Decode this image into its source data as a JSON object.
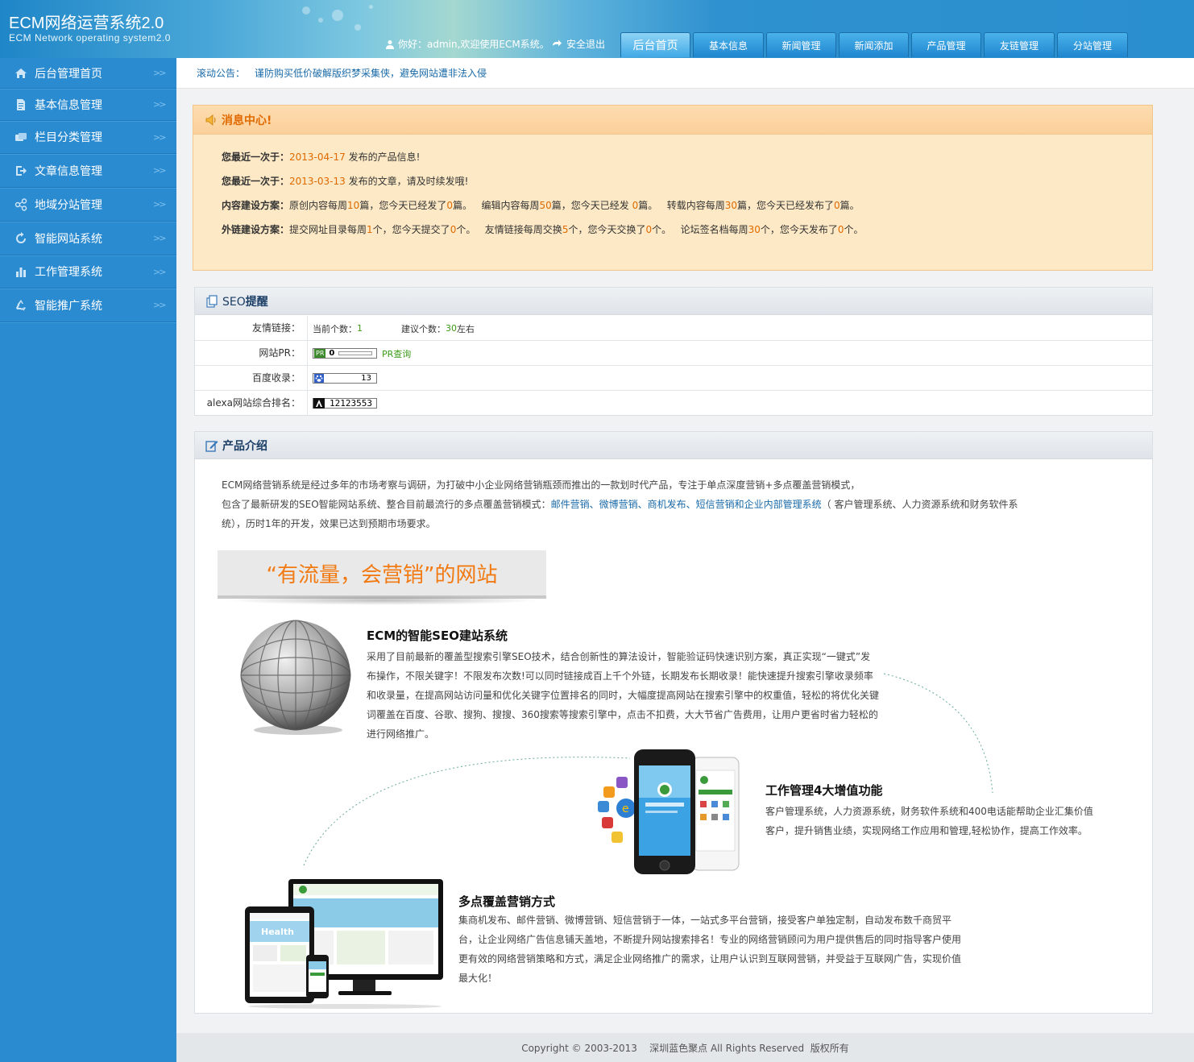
{
  "brand": {
    "title": "ECM网络运营系统2.0",
    "subtitle": "ECM Network operating system2.0"
  },
  "header": {
    "welcome": "你好：admin,欢迎使用ECM系统。",
    "logout": "安全退出",
    "tabs": [
      {
        "label": "后台首页",
        "active": true
      },
      {
        "label": "基本信息"
      },
      {
        "label": "新闻管理"
      },
      {
        "label": "新闻添加"
      },
      {
        "label": "产品管理"
      },
      {
        "label": "友链管理"
      },
      {
        "label": "分站管理"
      }
    ]
  },
  "sidebar": {
    "items": [
      {
        "label": "后台管理首页",
        "icon": "home-icon"
      },
      {
        "label": "基本信息管理",
        "icon": "document-icon"
      },
      {
        "label": "栏目分类管理",
        "icon": "category-icon"
      },
      {
        "label": "文章信息管理",
        "icon": "export-icon"
      },
      {
        "label": "地域分站管理",
        "icon": "share-icon"
      },
      {
        "label": "智能网站系统",
        "icon": "refresh-icon"
      },
      {
        "label": "工作管理系统",
        "icon": "bar-chart-icon"
      },
      {
        "label": "智能推广系统",
        "icon": "recycle-icon"
      }
    ],
    "chevron": ">>"
  },
  "notice": {
    "label": "滚动公告：",
    "text": "谨防购买低价破解版织梦采集侠，避免网站遭非法入侵"
  },
  "message_center": {
    "title": "消息中心!",
    "line1": {
      "prefix": "您最近一次于：",
      "date": "2013-04-17",
      "suffix": "发布的产品信息!"
    },
    "line2": {
      "prefix": "您最近一次于：",
      "date": "2013-03-13",
      "suffix": "发布的文章，请及时续发哦!"
    },
    "line3": {
      "label": "内容建设方案：",
      "a1": "原创内容每周",
      "n1": "10",
      "a2": "篇，您今天已经发了",
      "n2": "0",
      "a3": "篇。",
      "b1": "编辑内容每周",
      "n3": "50",
      "b2": "篇，您今天已经发",
      "n4": "0",
      "b3": "篇。",
      "c1": "转载内容每周",
      "n5": "30",
      "c2": "篇，您今天已经发布了",
      "n6": "0",
      "c3": "篇。"
    },
    "line4": {
      "label": "外链建设方案：",
      "a1": "提交网址目录每周",
      "n1": "1",
      "a2": "个，您今天提交了",
      "n2": "0",
      "a3": "个。",
      "b1": "友情链接每周交换",
      "n3": "5",
      "b2": "个，您今天交换了",
      "n4": "0",
      "b3": "个。",
      "c1": "论坛签名档每周",
      "n5": "30",
      "c2": "个，您今天发布了",
      "n6": "0",
      "c3": "个。"
    }
  },
  "seo": {
    "title": "SEO提醒",
    "title_prefix": "SEO",
    "title_suffix": "提醒",
    "rows": {
      "links": {
        "label": "友情链接：",
        "current_label": "当前个数：",
        "current": "1",
        "suggest_label": "建议个数：",
        "suggest": "30",
        "suggest_suffix": "左右"
      },
      "pr": {
        "label": "网站PR：",
        "badge": "PR",
        "value": "0",
        "link": "PR查询"
      },
      "baidu": {
        "label": "百度收录：",
        "value": "13"
      },
      "alexa": {
        "label": "alexa网站综合排名：",
        "value": "12123553"
      }
    }
  },
  "product": {
    "title": "产品介绍",
    "intro1": "ECM网络营销系统是经过多年的市场考察与调研，为打破中小企业网络营销瓶颈而推出的一款划时代产品，专注于单点深度营销+多点覆盖营销模式，",
    "intro2a": "包含了最新研发的SEO智能网站系统、整合目前最流行的多点覆盖营销模式：",
    "intro2link": "邮件营销、微博营销、商机发布、短信营销和企业内部管理系统",
    "intro2b": "（ 客户管理系统、人力资源系统和财务软件系",
    "intro3": "统），历时1年的开发，效果已达到预期市场要求。",
    "slogan": "“有流量，会营销”的网站",
    "features": [
      {
        "title": "ECM的智能SEO建站系统",
        "lines": [
          "采用了目前最新的覆盖型搜索引擎SEO技术，结合创新性的算法设计，智能验证码快速识别方案，真正实现“一键式”发",
          "布操作，不限关键字！不限发布次数!可以同时链接成百上千个外链，长期发布长期收录！能快速提升搜索引擎收录频率",
          "和收录量，在提高网站访问量和优化关键字位置排名的同时，大幅度提高网站在搜索引擎中的权重值，轻松的将优化关键",
          "词覆盖在百度、谷歌、搜狗、搜搜、360搜索等搜索引擎中，点击不扣费，大大节省广告费用，让用户更省时省力轻松的",
          "进行网络推广。"
        ]
      },
      {
        "title": "工作管理4大增值功能",
        "lines": [
          "客户管理系统，人力资源系统，财务软件系统和400电话能帮助企业汇集价值",
          "客户，提升销售业绩，实现网络工作应用和管理,轻松协作，提高工作效率。"
        ]
      },
      {
        "title": "多点覆盖营销方式",
        "lines": [
          "集商机发布、邮件营销、微博营销、短信营销于一体，一站式多平台营销，接受客户单独定制，自动发布数千商贸平",
          "台，让企业网络广告信息铺天盖地，不断提升网站搜索排名！专业的网络营销顾问为用户提供售后的同时指导客户使用",
          "更有效的网络营销策略和方式，满足企业网络推广的需求，让用户认识到互联网营销，并受益于互联网广告，实现价值",
          "最大化！"
        ]
      }
    ],
    "screen_text": "Health"
  },
  "footer": {
    "text": "Copyright © 2003-2013    深圳蓝色聚点 All Rights Reserved  版权所有"
  },
  "colors": {
    "sidebar": "#2b8bd0",
    "accent_orange": "#e06a00",
    "link_blue": "#1a6aa8",
    "green": "#3c9a18"
  }
}
